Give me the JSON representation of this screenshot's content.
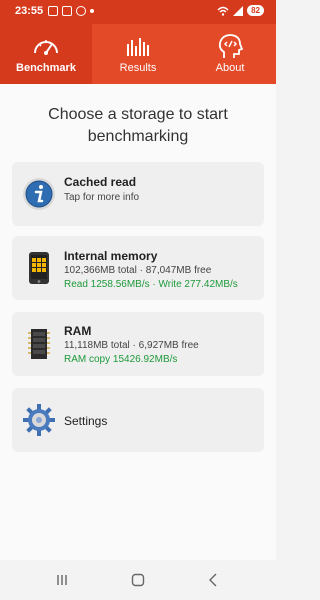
{
  "status": {
    "time": "23:55",
    "battery": "82"
  },
  "tabs": [
    {
      "label": "Benchmark",
      "icon": "speedometer-icon",
      "active": true
    },
    {
      "label": "Results",
      "icon": "bar-chart-icon",
      "active": false
    },
    {
      "label": "About",
      "icon": "head-code-icon",
      "active": false
    }
  ],
  "main": {
    "headline": "Choose a storage to start benchmarking",
    "cards": [
      {
        "title": "Cached read",
        "line1": "Tap for more info",
        "line2": ""
      },
      {
        "title": "Internal memory",
        "line1": "102,366MB total · 87,047MB free",
        "line2": "Read 1258.56MB/s · Write 277.42MB/s"
      },
      {
        "title": "RAM",
        "line1": "11,118MB total · 6,927MB free",
        "line2": "RAM copy 15426.92MB/s"
      },
      {
        "title": "Settings",
        "line1": "",
        "line2": ""
      }
    ]
  },
  "colors": {
    "accent": "#e24a28",
    "accent_dark": "#d63a1d",
    "green": "#1e9a3b"
  }
}
